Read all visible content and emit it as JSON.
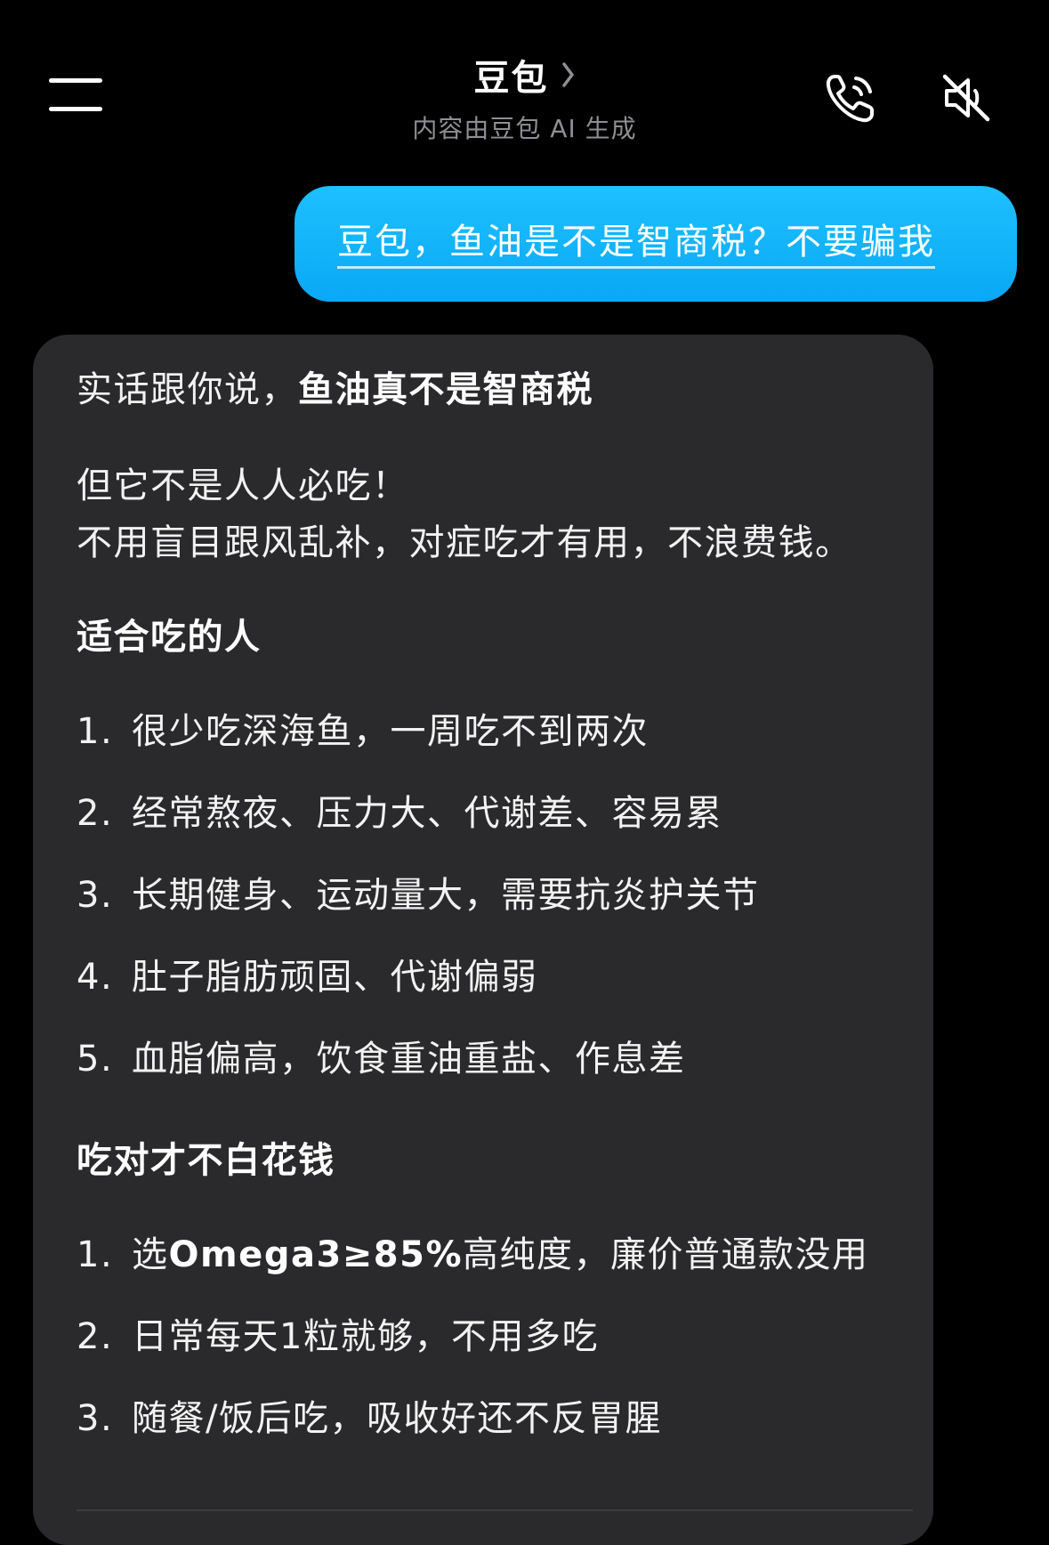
{
  "header": {
    "title": "豆包",
    "subtitle": "内容由豆包 AI 生成",
    "icons": {
      "menu": "menu-icon",
      "chevron": "chevron-right-icon",
      "phone": "phone-icon",
      "mute": "speaker-mute-icon"
    }
  },
  "user_message": {
    "text": "豆包，鱼油是不是智商税？不要骗我"
  },
  "ai_message": {
    "intro_plain": "实话跟你说，",
    "intro_bold": "鱼油真不是智商税",
    "para_line1": "但它不是人人必吃！",
    "para_line2": "不用盲目跟风乱补，对症吃才有用，不浪费钱。",
    "section1_title": "适合吃的人",
    "section1_items": [
      {
        "num": "1.",
        "text": "很少吃深海鱼，一周吃不到两次"
      },
      {
        "num": "2.",
        "text": "经常熬夜、压力大、代谢差、容易累"
      },
      {
        "num": "3.",
        "text": "长期健身、运动量大，需要抗炎护关节"
      },
      {
        "num": "4.",
        "text": "肚子脂肪顽固、代谢偏弱"
      },
      {
        "num": "5.",
        "text": "血脂偏高，饮食重油重盐、作息差"
      }
    ],
    "section2_title": "吃对才不白花钱",
    "section2_items": [
      {
        "num": "1.",
        "text_pre": "选",
        "text_bold": "Omega3≥85%",
        "text_post": "高纯度，廉价普通款没用"
      },
      {
        "num": "2.",
        "text": "日常每天1粒就够，不用多吃"
      },
      {
        "num": "3.",
        "text": "随餐/饭后吃，吸收好还不反胃腥"
      }
    ]
  },
  "colors": {
    "background": "#000000",
    "user_bubble": "#12b5fb",
    "ai_bubble": "#2a2a2c",
    "subtitle": "#8e8e93"
  }
}
